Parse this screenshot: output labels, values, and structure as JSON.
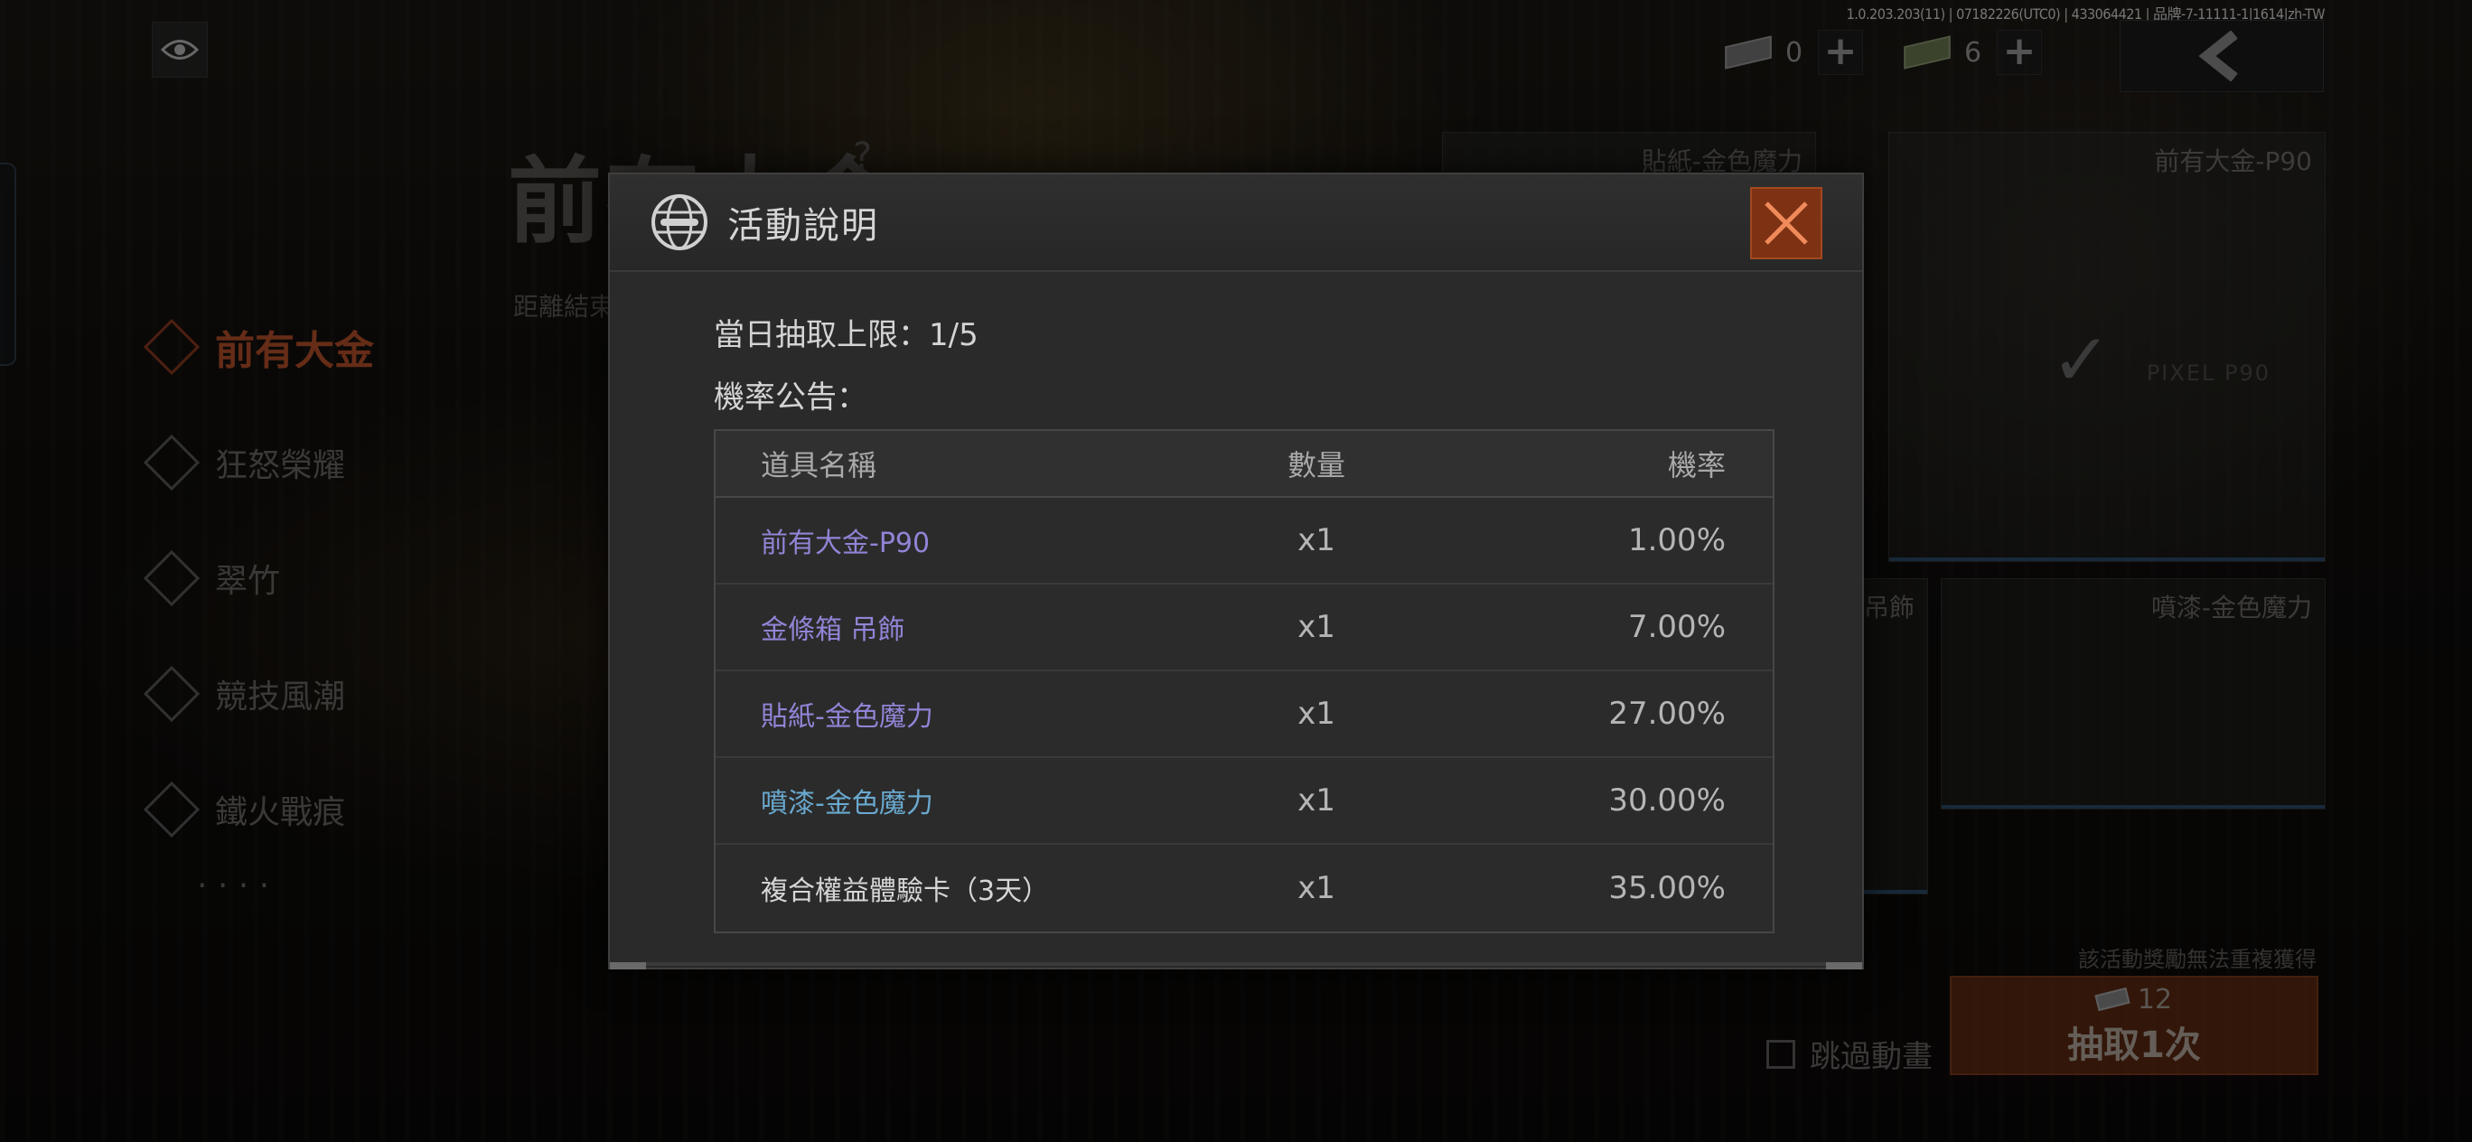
{
  "build_info": "1.0.203.203(11) | 07182226(UTC0) | 433064421 | 品牌-7-11111-1|1614|zh-TW",
  "currencies": [
    {
      "icon": "ticket-icon",
      "value": "0"
    },
    {
      "icon": "cash-icon",
      "value": "6"
    }
  ],
  "background": {
    "event_title": "前有大金",
    "help_mark": "?",
    "countdown_label": "距離結束",
    "nav_items": [
      {
        "label": "前有大金",
        "active": true
      },
      {
        "label": "狂怒榮耀",
        "active": false
      },
      {
        "label": "翠竹",
        "active": false
      },
      {
        "label": "競技風潮",
        "active": false
      },
      {
        "label": "鐵火戰痕",
        "active": false
      },
      {
        "label": "· · · ·",
        "active": false
      }
    ],
    "cards": {
      "sticker": "貼紙-金色魔力",
      "weapon": "前有大金-P90",
      "weapon_sub": "PIXEL P90",
      "charm_partial": "吊飾",
      "spray": "噴漆-金色魔力"
    },
    "no_repeat_notice": "該活動獎勵無法重複獲得",
    "draw_cost": "12",
    "draw_label": "抽取1次",
    "skip_animation": "跳過動畫"
  },
  "modal": {
    "title": "活動說明",
    "daily_limit": "當日抽取上限：1/5",
    "announcement": "機率公告：",
    "columns": {
      "name": "道具名稱",
      "qty": "數量",
      "rate": "機率"
    },
    "rows": [
      {
        "name": "前有大金-P90",
        "qty": "x1",
        "rate": "1.00%",
        "color": "#9184d6"
      },
      {
        "name": "金條箱 吊飾",
        "qty": "x1",
        "rate": "7.00%",
        "color": "#9184d6"
      },
      {
        "name": "貼紙-金色魔力",
        "qty": "x1",
        "rate": "27.00%",
        "color": "#9184d6"
      },
      {
        "name": "噴漆-金色魔力",
        "qty": "x1",
        "rate": "30.00%",
        "color": "#6aa9cf"
      },
      {
        "name": "複合權益體驗卡（3天）",
        "qty": "x1",
        "rate": "35.00%",
        "color": "#d6d6d6"
      }
    ]
  },
  "colors": {
    "accent": "#b8502a",
    "close_button": "#7e3214"
  }
}
